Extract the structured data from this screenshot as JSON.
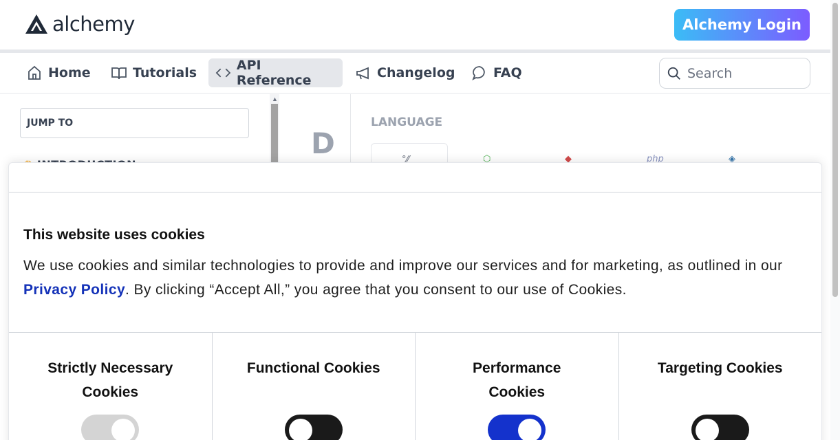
{
  "header": {
    "logo_text": "alchemy",
    "login_button": "Alchemy Login",
    "brand_gradient": [
      "#3bbcf6",
      "#7c5cff"
    ]
  },
  "nav": {
    "items": [
      {
        "label": "Home",
        "icon": "home-icon"
      },
      {
        "label": "Tutorials",
        "icon": "book-icon"
      },
      {
        "label": "API Reference",
        "icon": "code-icon",
        "active": true
      },
      {
        "label": "Changelog",
        "icon": "megaphone-icon"
      },
      {
        "label": "FAQ",
        "icon": "chat-bubble-icon"
      }
    ],
    "search_placeholder": "Search"
  },
  "sidebar": {
    "jump_to": "JUMP TO",
    "section_label": "INTRODUCTION"
  },
  "content": {
    "section_letter": "D",
    "language_label": "LANGUAGE",
    "languages": [
      {
        "label": "curl",
        "icon": "shell-icon"
      },
      {
        "label": "node",
        "icon": "nodejs-icon"
      },
      {
        "label": "ruby",
        "icon": "ruby-icon"
      },
      {
        "label": "php",
        "icon": "php-icon"
      },
      {
        "label": "python",
        "icon": "python-icon"
      }
    ]
  },
  "cookie_modal": {
    "title": "This website uses cookies",
    "text_before_link": "We use cookies and similar technologies to provide and improve our services and for marketing, as outlined in our ",
    "link_text": "Privacy Policy",
    "text_after_link": ". By clicking “Accept All,” you agree that you consent to our use of Cookies.",
    "categories": [
      {
        "title": "Strictly Necessary Cookies",
        "state": "always-on"
      },
      {
        "title": "Functional Cookies",
        "state": "off"
      },
      {
        "title": "Performance Cookies",
        "state": "on"
      },
      {
        "title": "Targeting Cookies",
        "state": "off"
      }
    ],
    "colors": {
      "toggle_on": "#1432cc",
      "toggle_off": "#1a1a1a",
      "toggle_disabled": "#d4d4d4",
      "link": "#1432b8"
    }
  }
}
